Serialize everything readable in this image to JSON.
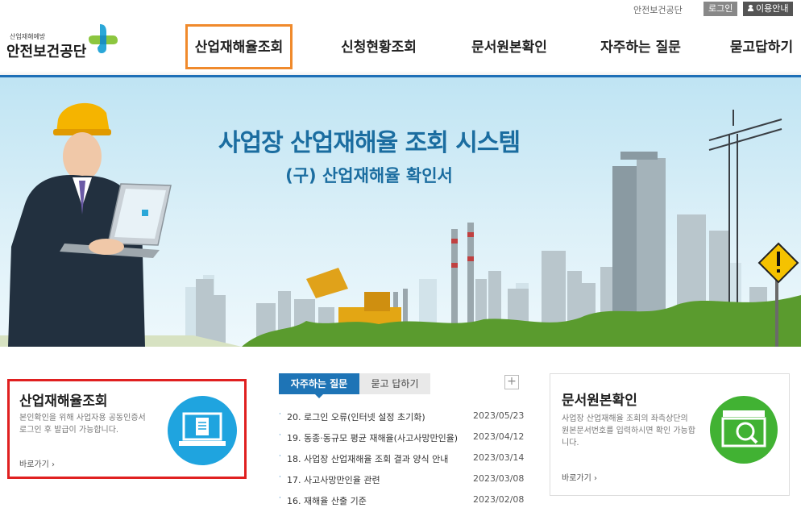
{
  "top": {
    "org_link": "안전보건공단",
    "login": "로그인",
    "guide": "이용안내"
  },
  "logo": {
    "small": "산업재해예방",
    "main": "안전보건공단"
  },
  "nav": [
    {
      "label": "산업재해율조회",
      "active": true
    },
    {
      "label": "신청현황조회",
      "active": false
    },
    {
      "label": "문서원본확인",
      "active": false
    },
    {
      "label": "자주하는 질문",
      "active": false
    },
    {
      "label": "묻고답하기",
      "active": false
    }
  ],
  "banner": {
    "title": "사업장 산업재해율 조회 시스템",
    "subtitle": "(구) 산업재해율 확인서"
  },
  "industrial": {
    "title": "산업재해율조회",
    "desc_line1": "본인확인을 위해 사업자용 공동인증서",
    "desc_line2": "로그인 후 발급이 가능합니다.",
    "link": "바로가기 ›",
    "icon": "computer-document-icon"
  },
  "faq": {
    "tab_faq": "자주하는 질문",
    "tab_qa": "묻고 답하기",
    "more": "+",
    "items": [
      {
        "q": "20. 로그인 오류(인터넷 설정 초기화)",
        "date": "2023/05/23"
      },
      {
        "q": "19. 동종·동규모 평균 재해율(사고사망만인율)",
        "date": "2023/04/12"
      },
      {
        "q": "18. 사업장 산업재해율 조회 결과 양식 안내",
        "date": "2023/03/14"
      },
      {
        "q": "17. 사고사망만인율 관련",
        "date": "2023/03/08"
      },
      {
        "q": "16. 재해율 산출 기준",
        "date": "2023/02/08"
      }
    ]
  },
  "docs": {
    "title": "문서원본확인",
    "desc_line1": "사업장 산업재해율 조회의 좌측상단의",
    "desc_line2": "원본문서번호를 입력하시면 확인 가능합",
    "desc_line3": "니다.",
    "link": "바로가기 ›",
    "icon": "document-search-icon"
  },
  "colors": {
    "brand_blue": "#1e74b6",
    "active_highlight": "#f08a2c",
    "card_highlight": "#e02020",
    "icon_blue": "#1fa4df",
    "icon_green": "#41b233"
  }
}
